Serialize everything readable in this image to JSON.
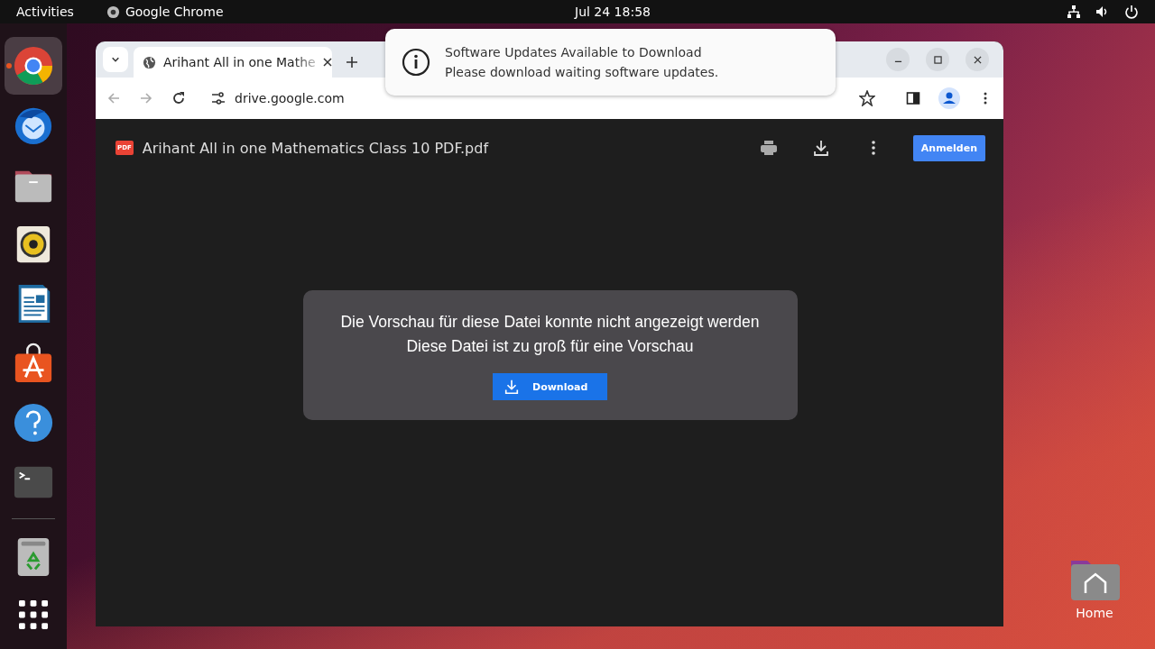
{
  "top_bar": {
    "activities": "Activities",
    "app_name": "Google Chrome",
    "clock": "Jul 24  18:58"
  },
  "dock": {
    "apps": [
      {
        "kind": "chrome",
        "running": true
      },
      {
        "kind": "mail",
        "running": false
      },
      {
        "kind": "files",
        "running": false
      },
      {
        "kind": "music",
        "running": false
      },
      {
        "kind": "writer",
        "running": false
      },
      {
        "kind": "store",
        "running": false
      },
      {
        "kind": "help",
        "running": false
      },
      {
        "kind": "terminal",
        "running": false
      }
    ],
    "pinned_bottom": [
      {
        "kind": "trash"
      },
      {
        "kind": "grid"
      }
    ]
  },
  "browser": {
    "tab": {
      "title": "Arihant All in one Mathe",
      "selected": true
    },
    "url": {
      "host": "drive.google.com"
    },
    "viewer": {
      "file_name": "Arihant All in one Mathematics Class 10 PDF.pdf",
      "file_badge": "PDF",
      "sign_in": "Anmelden",
      "message_lines": [
        "Die Vorschau für diese Datei konnte nicht angezeigt werden",
        "Diese Datei ist zu groß für eine Vorschau"
      ],
      "download": "Download"
    }
  },
  "notification": {
    "title": "Software Updates Available to Download",
    "body": "Please download waiting software updates."
  },
  "desktop_icons": [
    {
      "label": "Home"
    }
  ]
}
